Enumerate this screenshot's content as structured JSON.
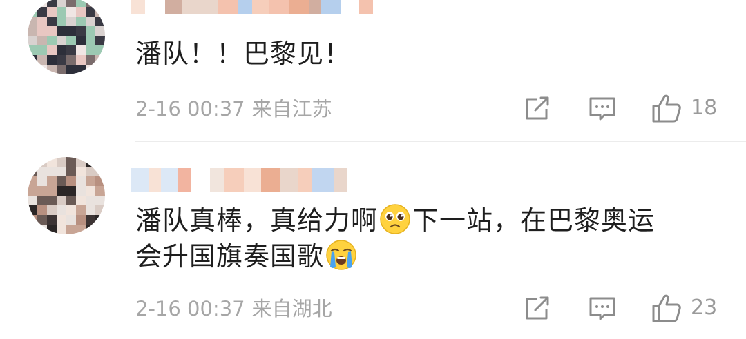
{
  "comments": [
    {
      "text": "潘队！！巴黎见！",
      "date": "2-16 00:37",
      "location": "来自江苏",
      "likes": "18",
      "username_blurred": true,
      "avatar_blurred": true,
      "avatar_palette": [
        "#d9d2d0",
        "#7a6c6c",
        "#3a3a44",
        "#c9b6b0",
        "#e8c7c2",
        "#2d2f3a",
        "#9cc9b2",
        "#f0e6e4"
      ]
    },
    {
      "text_part1": "潘队真棒，真给力啊",
      "text_part2": "下一站，在巴黎奥运",
      "text_line2": "会升国旗奏国歌",
      "emoji1": "pleading-face-emoji",
      "emoji2": "crying-face-emoji",
      "date": "2-16 00:37",
      "location": "来自湖北",
      "likes": "23",
      "username_blurred": true,
      "avatar_blurred": true,
      "avatar_palette": [
        "#e9e2de",
        "#3d3434",
        "#6a5a55",
        "#c8a595",
        "#f1e4dc",
        "#2b2626",
        "#b89080",
        "#d9cbc4"
      ]
    }
  ],
  "icons": {
    "share": "share-icon",
    "reply": "reply-comment-icon",
    "like": "thumbs-up-icon"
  },
  "colors": {
    "meta_text": "#a6a6a6",
    "icon_stroke": "#8c8c8c",
    "divider": "#ececec"
  }
}
